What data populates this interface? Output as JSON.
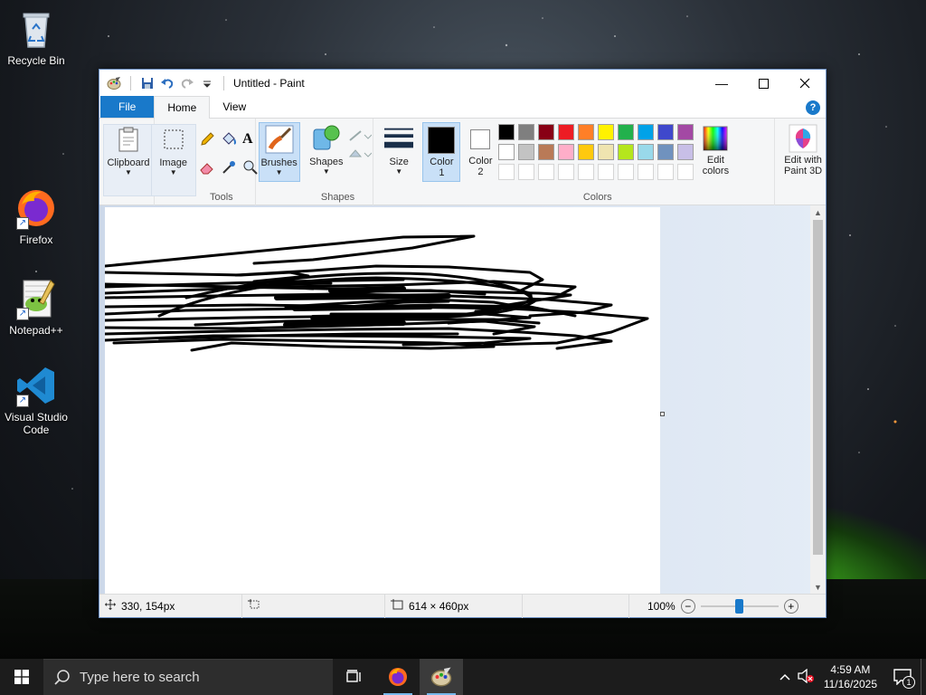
{
  "desktop": {
    "icons": [
      {
        "label": "Recycle Bin"
      },
      {
        "label": "Firefox"
      },
      {
        "label": "Notepad++"
      },
      {
        "label": "Visual Studio Code"
      }
    ]
  },
  "window": {
    "title": "Untitled - Paint",
    "tabs": [
      "File",
      "Home",
      "View"
    ],
    "help": "?"
  },
  "ribbon": {
    "clipboard": "Clipboard",
    "image": "Image",
    "tools_label": "Tools",
    "brushes": "Brushes",
    "shapes": "Shapes",
    "shapes_group": "Shapes",
    "size": "Size",
    "color1_a": "Color",
    "color1_b": "1",
    "color2_a": "Color",
    "color2_b": "2",
    "edit_colors_a": "Edit",
    "edit_colors_b": "colors",
    "colors_group": "Colors",
    "paint3d_a": "Edit with",
    "paint3d_b": "Paint 3D",
    "palette_row1": [
      "#000000",
      "#7f7f7f",
      "#880015",
      "#ed1c24",
      "#ff7f27",
      "#fff200",
      "#22b14c",
      "#00a2e8",
      "#3f48cc",
      "#a349a4"
    ],
    "palette_row2": [
      "#ffffff",
      "#c3c3c3",
      "#b97a57",
      "#ffaec9",
      "#ffc90e",
      "#efe4b0",
      "#b5e61d",
      "#99d9ea",
      "#7092be",
      "#c8bfe7"
    ],
    "color1_value": "#000000",
    "color2_value": "#ffffff"
  },
  "status": {
    "cursor_pos": "330, 154px",
    "image_size": "614 × 460px",
    "zoom": "100%",
    "zoom_fraction": 0.5
  },
  "taskbar": {
    "search_placeholder": "Type here to search",
    "time": "4:59 AM",
    "date": "11/16/2025",
    "notifications": "1"
  }
}
